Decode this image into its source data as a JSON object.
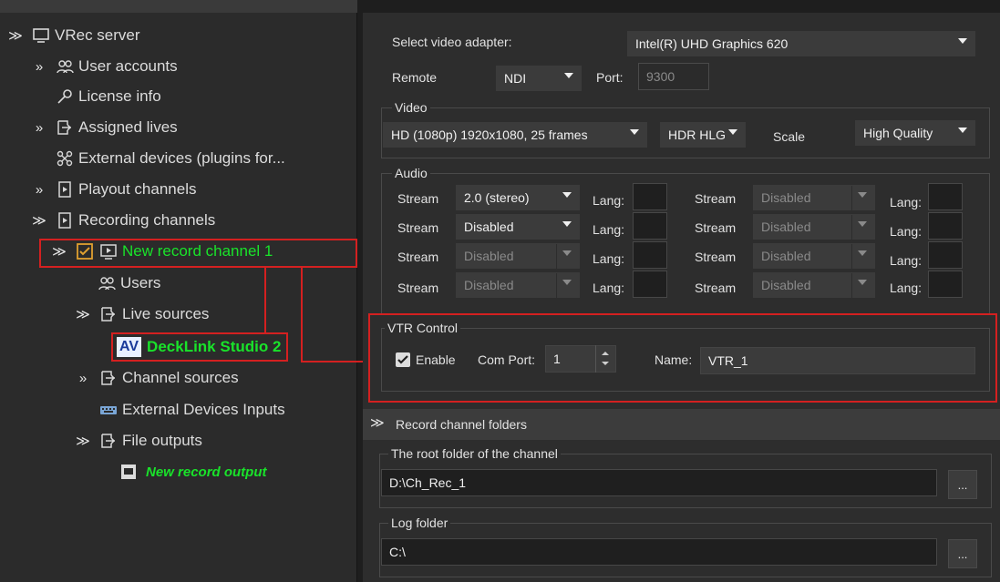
{
  "tree": {
    "root": "VRec server",
    "user_accounts": "User accounts",
    "license_info": "License info",
    "assigned_lives": "Assigned lives",
    "external_devices": "External devices (plugins for...",
    "playout_channels": "Playout channels",
    "recording_channels": "Recording channels",
    "new_record_channel": "New record channel 1",
    "users": "Users",
    "live_sources": "Live sources",
    "av_badge": "AV",
    "decklink": "DeckLink Studio 2",
    "channel_sources": "Channel sources",
    "external_devices_inputs": "External Devices Inputs",
    "file_outputs": "File outputs",
    "new_record_output": "New record output"
  },
  "settings": {
    "select_video_adapter_label": "Select video adapter:",
    "video_adapter_value": "Intel(R) UHD Graphics 620",
    "remote_label": "Remote",
    "remote_value": "NDI",
    "port_label": "Port:",
    "port_value": "9300",
    "video_group": "Video",
    "video_format": "HD (1080p) 1920x1080, 25 frames",
    "hdr_value": "HDR HLG",
    "scale_label": "Scale",
    "scale_value": "High Quality",
    "audio_group": "Audio",
    "stream_label": "Stream",
    "lang_label": "Lang:",
    "audio_rows": [
      {
        "left_value": "2.0 (stereo)",
        "right_value": "Disabled"
      },
      {
        "left_value": "Disabled",
        "right_value": "Disabled"
      },
      {
        "left_value": "Disabled",
        "right_value": "Disabled"
      },
      {
        "left_value": "Disabled",
        "right_value": "Disabled"
      }
    ],
    "vtr_group": "VTR Control",
    "enable_label": "Enable",
    "com_port_label": "Com Port:",
    "com_port_value": "1",
    "name_label": "Name:",
    "name_value": "VTR_1",
    "folders_header": "Record channel folders",
    "root_folder_group": "The root folder of the channel",
    "root_folder_value": "D:\\Ch_Rec_1",
    "log_folder_group": "Log folder",
    "log_folder_value": "C:\\",
    "browse_label": "..."
  },
  "colors": {
    "highlight_red": "#d42020",
    "active_green": "#19e32a",
    "panel_bg": "#2d2d2d"
  }
}
